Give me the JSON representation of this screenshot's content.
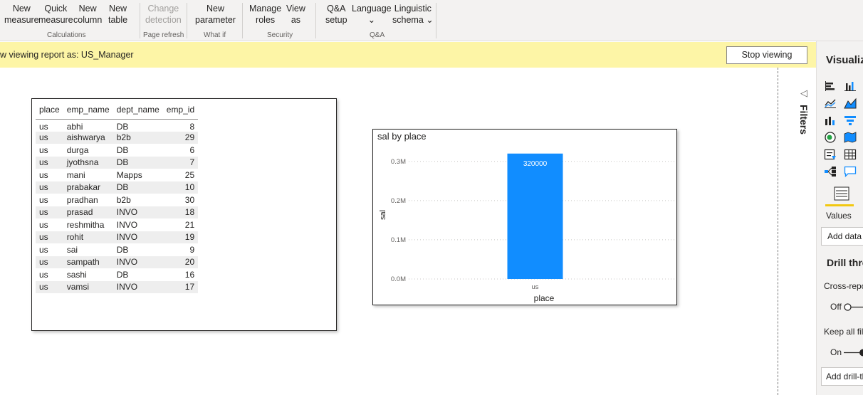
{
  "ribbon": {
    "buttons": {
      "new_measure": [
        "New",
        "measure"
      ],
      "quick_measure": [
        "Quick",
        "measure"
      ],
      "new_column": [
        "New",
        "column"
      ],
      "new_table": [
        "New",
        "table"
      ],
      "change_detection": [
        "Change",
        "detection"
      ],
      "new_parameter": [
        "New",
        "parameter"
      ],
      "manage_roles": [
        "Manage",
        "roles"
      ],
      "view_as": [
        "View",
        "as"
      ],
      "qa_setup": [
        "Q&A",
        "setup"
      ],
      "language": [
        "Language",
        "⌄"
      ],
      "linguistic_schema": [
        "Linguistic",
        "schema ⌄"
      ]
    },
    "groups": {
      "calculations": "Calculations",
      "page_refresh": "Page refresh",
      "what_if": "What if",
      "security": "Security",
      "qa": "Q&A"
    }
  },
  "banner": {
    "text": "w viewing report as: US_Manager",
    "stop_label": "Stop viewing"
  },
  "table": {
    "columns": [
      "place",
      "emp_name",
      "dept_name",
      "emp_id"
    ],
    "rows": [
      [
        "us",
        "abhi",
        "DB",
        "8"
      ],
      [
        "us",
        "aishwarya",
        "b2b",
        "29"
      ],
      [
        "us",
        "durga",
        "DB",
        "6"
      ],
      [
        "us",
        "jyothsna",
        "DB",
        "7"
      ],
      [
        "us",
        "mani",
        "Mapps",
        "25"
      ],
      [
        "us",
        "prabakar",
        "DB",
        "10"
      ],
      [
        "us",
        "pradhan",
        "b2b",
        "30"
      ],
      [
        "us",
        "prasad",
        "INVO",
        "18"
      ],
      [
        "us",
        "reshmitha",
        "INVO",
        "21"
      ],
      [
        "us",
        "rohit",
        "INVO",
        "19"
      ],
      [
        "us",
        "sai",
        "DB",
        "9"
      ],
      [
        "us",
        "sampath",
        "INVO",
        "20"
      ],
      [
        "us",
        "sashi",
        "DB",
        "16"
      ],
      [
        "us",
        "vamsi",
        "INVO",
        "17"
      ]
    ]
  },
  "chart_data": {
    "type": "bar",
    "title": "sal by place",
    "categories": [
      "us"
    ],
    "values": [
      320000
    ],
    "data_labels": [
      "320000"
    ],
    "xlabel": "place",
    "ylabel": "sal",
    "yticks": [
      "0.0M",
      "0.1M",
      "0.2M",
      "0.3M"
    ],
    "ylim": [
      0,
      345000
    ],
    "grid": true,
    "bar_color": "#118dff"
  },
  "filters": {
    "label": "Filters"
  },
  "viz_pane": {
    "title": "Visualizations",
    "values_label": "Values",
    "add_data_label": "Add data fields here",
    "drill_title": "Drill through",
    "cross_report_label": "Cross-report",
    "off_label": "Off",
    "keep_filters_label": "Keep all filters",
    "on_label": "On",
    "add_drill_label": "Add drill-through fields here"
  },
  "colors": {
    "accent": "#f2c811",
    "banner_bg": "#fdf5a6",
    "bar": "#118dff"
  }
}
